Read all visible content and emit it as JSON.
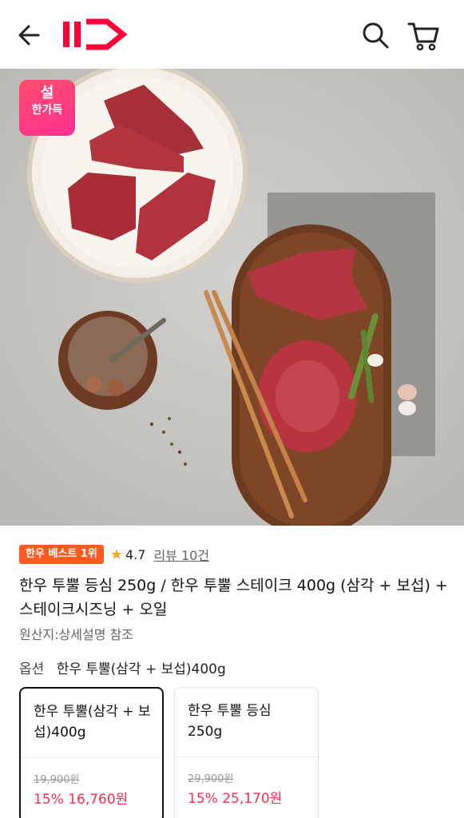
{
  "header": {
    "logo_text": "11",
    "icons": {
      "back": "back-arrow-icon",
      "search": "search-icon",
      "cart": "cart-icon"
    },
    "brand_color": "#ff0038"
  },
  "hero": {
    "sticker_line1": "설",
    "sticker_line2": "한가득"
  },
  "product": {
    "best_tag": "한우 베스트 1위",
    "rating": "4.7",
    "review_link": "리뷰 10건",
    "title": "한우 투뿔 등심 250g / 한우 투뿔 스테이크 400g (삼각 + 보섭) + 스테이크시즈닝 + 오일",
    "origin": "원산지:상세설명 참조"
  },
  "option": {
    "label": "옵션",
    "selected_value": "한우 투뿔(삼각 + 보섭)400g",
    "cards": [
      {
        "name": "한우 투뿔(삼각 + 보섭)400g",
        "original_price": "19,900원",
        "sale_price": "15% 16,760원",
        "selected": true
      },
      {
        "name": "한우 투뿔 등심 250g",
        "original_price": "29,900원",
        "sale_price": "15% 25,170원",
        "selected": false
      }
    ]
  },
  "colors": {
    "accent": "#ff2a4d",
    "best_tag": "#ff5a1f",
    "star": "#f5a623"
  }
}
